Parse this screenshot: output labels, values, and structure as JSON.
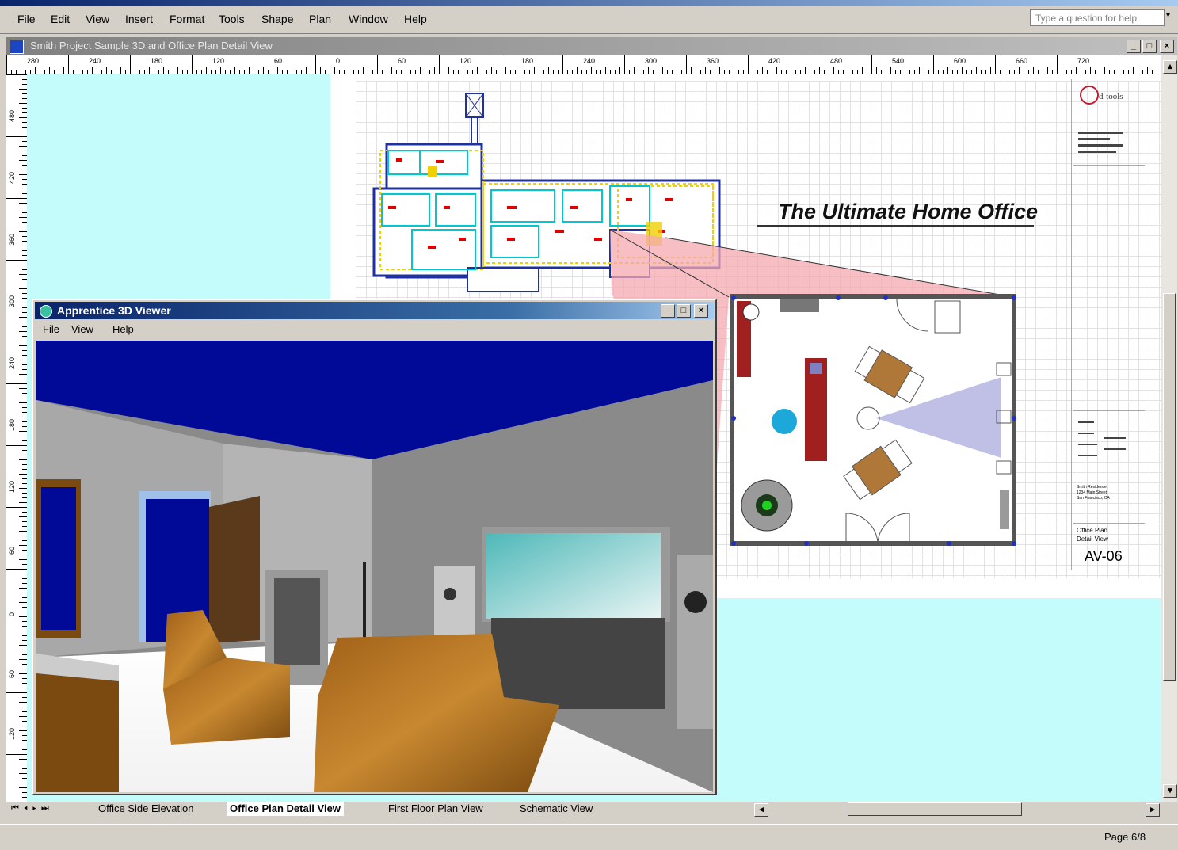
{
  "app": {
    "menu": [
      "File",
      "Edit",
      "View",
      "Insert",
      "Format",
      "Tools",
      "Shape",
      "Plan",
      "Window",
      "Help"
    ],
    "help_placeholder": "Type a question for help"
  },
  "document": {
    "title": "Smith Project Sample 3D and Office Plan Detail View",
    "ruler_labels": [
      "280",
      "240",
      "180",
      "120",
      "60",
      "0",
      "60",
      "120",
      "180",
      "240",
      "300",
      "360",
      "420",
      "480",
      "540",
      "600",
      "660",
      "720"
    ],
    "ruler_left_labels": [
      "480",
      "420",
      "360",
      "300",
      "240",
      "180",
      "120",
      "60",
      "0",
      "60",
      "120"
    ],
    "headline": "The Ultimate Home Office",
    "title_block": {
      "logo_text": "d-tools",
      "client": "Smith Residence",
      "address1": "1234 Main Street",
      "address2": "San Francisco, CA",
      "drawing_name": "Office Plan Detail View",
      "sheet": "AV-06"
    }
  },
  "viewer": {
    "title": "Apprentice 3D Viewer",
    "menu": [
      "File",
      "View",
      "Help"
    ]
  },
  "tabs": [
    "Office Side Elevation",
    "Office Plan Detail View",
    "First Floor Plan View",
    "Schematic View"
  ],
  "active_tab": "Office Plan Detail View",
  "status": {
    "page": "Page 6/8"
  }
}
